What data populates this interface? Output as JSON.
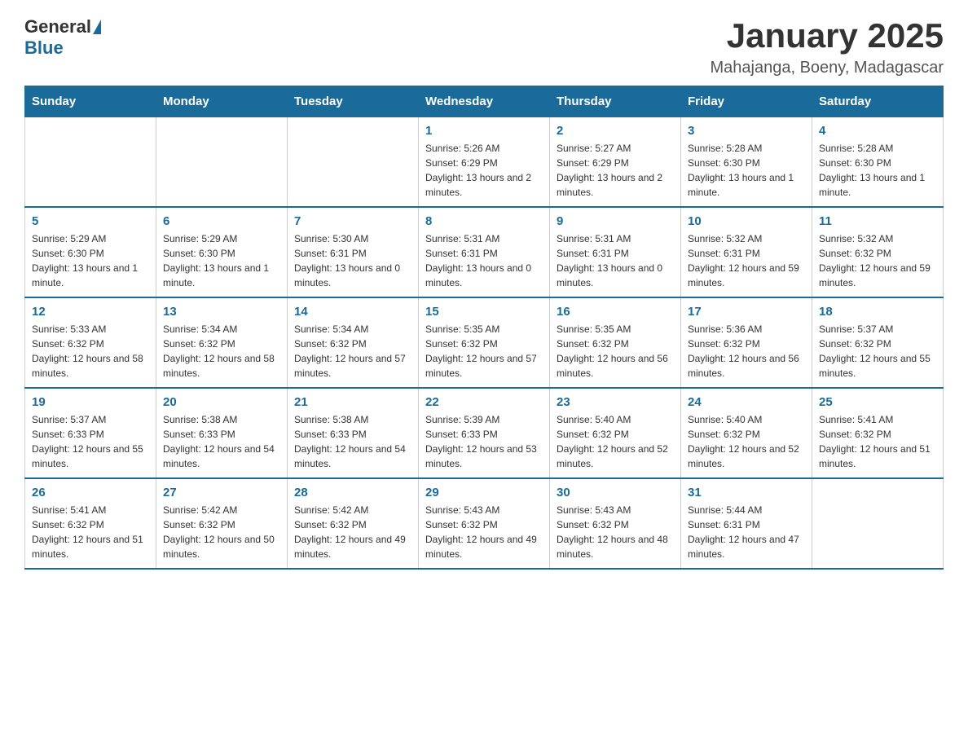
{
  "header": {
    "title": "January 2025",
    "location": "Mahajanga, Boeny, Madagascar",
    "logo_general": "General",
    "logo_blue": "Blue"
  },
  "days_of_week": [
    "Sunday",
    "Monday",
    "Tuesday",
    "Wednesday",
    "Thursday",
    "Friday",
    "Saturday"
  ],
  "weeks": [
    [
      {
        "day": "",
        "info": ""
      },
      {
        "day": "",
        "info": ""
      },
      {
        "day": "",
        "info": ""
      },
      {
        "day": "1",
        "info": "Sunrise: 5:26 AM\nSunset: 6:29 PM\nDaylight: 13 hours and 2 minutes."
      },
      {
        "day": "2",
        "info": "Sunrise: 5:27 AM\nSunset: 6:29 PM\nDaylight: 13 hours and 2 minutes."
      },
      {
        "day": "3",
        "info": "Sunrise: 5:28 AM\nSunset: 6:30 PM\nDaylight: 13 hours and 1 minute."
      },
      {
        "day": "4",
        "info": "Sunrise: 5:28 AM\nSunset: 6:30 PM\nDaylight: 13 hours and 1 minute."
      }
    ],
    [
      {
        "day": "5",
        "info": "Sunrise: 5:29 AM\nSunset: 6:30 PM\nDaylight: 13 hours and 1 minute."
      },
      {
        "day": "6",
        "info": "Sunrise: 5:29 AM\nSunset: 6:30 PM\nDaylight: 13 hours and 1 minute."
      },
      {
        "day": "7",
        "info": "Sunrise: 5:30 AM\nSunset: 6:31 PM\nDaylight: 13 hours and 0 minutes."
      },
      {
        "day": "8",
        "info": "Sunrise: 5:31 AM\nSunset: 6:31 PM\nDaylight: 13 hours and 0 minutes."
      },
      {
        "day": "9",
        "info": "Sunrise: 5:31 AM\nSunset: 6:31 PM\nDaylight: 13 hours and 0 minutes."
      },
      {
        "day": "10",
        "info": "Sunrise: 5:32 AM\nSunset: 6:31 PM\nDaylight: 12 hours and 59 minutes."
      },
      {
        "day": "11",
        "info": "Sunrise: 5:32 AM\nSunset: 6:32 PM\nDaylight: 12 hours and 59 minutes."
      }
    ],
    [
      {
        "day": "12",
        "info": "Sunrise: 5:33 AM\nSunset: 6:32 PM\nDaylight: 12 hours and 58 minutes."
      },
      {
        "day": "13",
        "info": "Sunrise: 5:34 AM\nSunset: 6:32 PM\nDaylight: 12 hours and 58 minutes."
      },
      {
        "day": "14",
        "info": "Sunrise: 5:34 AM\nSunset: 6:32 PM\nDaylight: 12 hours and 57 minutes."
      },
      {
        "day": "15",
        "info": "Sunrise: 5:35 AM\nSunset: 6:32 PM\nDaylight: 12 hours and 57 minutes."
      },
      {
        "day": "16",
        "info": "Sunrise: 5:35 AM\nSunset: 6:32 PM\nDaylight: 12 hours and 56 minutes."
      },
      {
        "day": "17",
        "info": "Sunrise: 5:36 AM\nSunset: 6:32 PM\nDaylight: 12 hours and 56 minutes."
      },
      {
        "day": "18",
        "info": "Sunrise: 5:37 AM\nSunset: 6:32 PM\nDaylight: 12 hours and 55 minutes."
      }
    ],
    [
      {
        "day": "19",
        "info": "Sunrise: 5:37 AM\nSunset: 6:33 PM\nDaylight: 12 hours and 55 minutes."
      },
      {
        "day": "20",
        "info": "Sunrise: 5:38 AM\nSunset: 6:33 PM\nDaylight: 12 hours and 54 minutes."
      },
      {
        "day": "21",
        "info": "Sunrise: 5:38 AM\nSunset: 6:33 PM\nDaylight: 12 hours and 54 minutes."
      },
      {
        "day": "22",
        "info": "Sunrise: 5:39 AM\nSunset: 6:33 PM\nDaylight: 12 hours and 53 minutes."
      },
      {
        "day": "23",
        "info": "Sunrise: 5:40 AM\nSunset: 6:32 PM\nDaylight: 12 hours and 52 minutes."
      },
      {
        "day": "24",
        "info": "Sunrise: 5:40 AM\nSunset: 6:32 PM\nDaylight: 12 hours and 52 minutes."
      },
      {
        "day": "25",
        "info": "Sunrise: 5:41 AM\nSunset: 6:32 PM\nDaylight: 12 hours and 51 minutes."
      }
    ],
    [
      {
        "day": "26",
        "info": "Sunrise: 5:41 AM\nSunset: 6:32 PM\nDaylight: 12 hours and 51 minutes."
      },
      {
        "day": "27",
        "info": "Sunrise: 5:42 AM\nSunset: 6:32 PM\nDaylight: 12 hours and 50 minutes."
      },
      {
        "day": "28",
        "info": "Sunrise: 5:42 AM\nSunset: 6:32 PM\nDaylight: 12 hours and 49 minutes."
      },
      {
        "day": "29",
        "info": "Sunrise: 5:43 AM\nSunset: 6:32 PM\nDaylight: 12 hours and 49 minutes."
      },
      {
        "day": "30",
        "info": "Sunrise: 5:43 AM\nSunset: 6:32 PM\nDaylight: 12 hours and 48 minutes."
      },
      {
        "day": "31",
        "info": "Sunrise: 5:44 AM\nSunset: 6:31 PM\nDaylight: 12 hours and 47 minutes."
      },
      {
        "day": "",
        "info": ""
      }
    ]
  ]
}
